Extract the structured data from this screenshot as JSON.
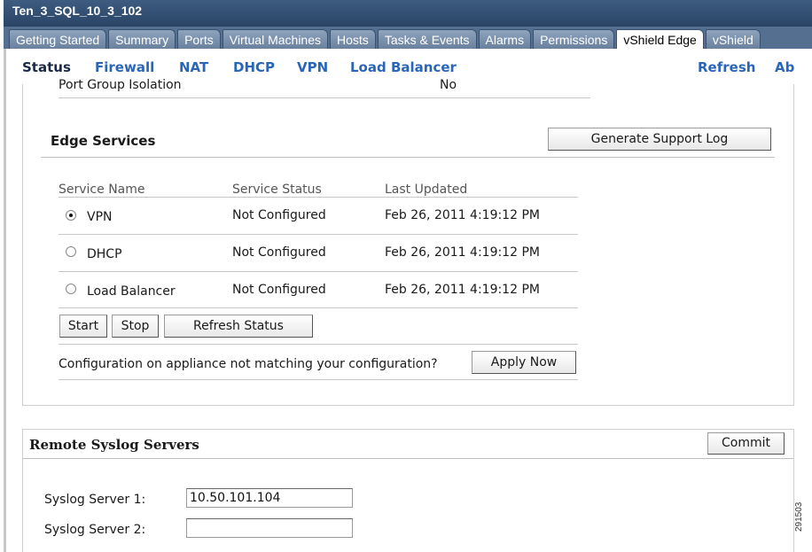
{
  "window": {
    "title": "Ten_3_SQL_10_3_102"
  },
  "tabs": [
    {
      "label": "Getting Started",
      "active": false
    },
    {
      "label": "Summary",
      "active": false
    },
    {
      "label": "Ports",
      "active": false
    },
    {
      "label": "Virtual Machines",
      "active": false
    },
    {
      "label": "Hosts",
      "active": false
    },
    {
      "label": "Tasks & Events",
      "active": false
    },
    {
      "label": "Alarms",
      "active": false
    },
    {
      "label": "Permissions",
      "active": false
    },
    {
      "label": "vShield Edge",
      "active": true
    },
    {
      "label": "vShield",
      "active": false
    }
  ],
  "subnav": {
    "status": "Status",
    "firewall": "Firewall",
    "nat": "NAT",
    "dhcp": "DHCP",
    "vpn": "VPN",
    "load_balancer": "Load Balancer",
    "refresh": "Refresh",
    "about": "Ab"
  },
  "port_group": {
    "label": "Port Group Isolation",
    "value": "No"
  },
  "edge_services": {
    "title": "Edge Services",
    "generate_log_label": "Generate Support Log",
    "columns": [
      "Service Name",
      "Service Status",
      "Last Updated"
    ],
    "rows": [
      {
        "name": "VPN",
        "status": "Not Configured",
        "updated": "Feb 26, 2011 4:19:12 PM",
        "selected": true
      },
      {
        "name": "DHCP",
        "status": "Not Configured",
        "updated": "Feb 26, 2011 4:19:12 PM",
        "selected": false
      },
      {
        "name": "Load Balancer",
        "status": "Not Configured",
        "updated": "Feb 26, 2011 4:19:12 PM",
        "selected": false
      }
    ],
    "start_label": "Start",
    "stop_label": "Stop",
    "refresh_status_label": "Refresh Status",
    "mismatch_text": "Configuration on appliance not matching your configuration?",
    "apply_now_label": "Apply Now"
  },
  "syslog": {
    "title": "Remote Syslog Servers",
    "commit_label": "Commit",
    "server1_label": "Syslog Server 1:",
    "server1_value": "10.50.101.104",
    "server2_label": "Syslog Server 2:",
    "server2_value": ""
  },
  "figure_number": "291503",
  "colors": {
    "title_bar": "#2f4b6e",
    "tab_strip": "#546f8f",
    "link": "#2a66b8"
  }
}
